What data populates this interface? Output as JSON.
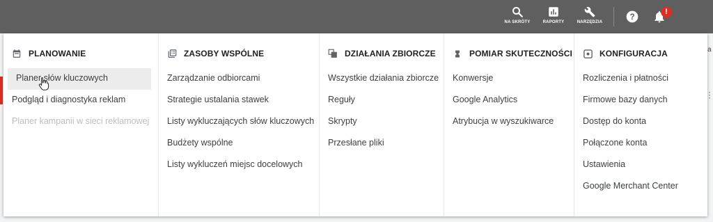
{
  "toolbar": {
    "search_label": "NA SKRÓTY",
    "reports_label": "RAPORTY",
    "tools_label": "NARZĘDZIA",
    "notification_badge": "!",
    "icons": [
      "search-icon",
      "reports-icon",
      "wrench-icon",
      "help-icon",
      "bell-icon"
    ]
  },
  "behind": {
    "fragment": "a"
  },
  "menu": {
    "columns": [
      {
        "icon": "calendar-icon",
        "title": "PLANOWANIE",
        "items": [
          {
            "label": "Planer słów kluczowych",
            "state": "hover"
          },
          {
            "label": "Podgląd i diagnostyka reklam",
            "state": "normal"
          },
          {
            "label": "Planer kampanii w sieci reklamowej",
            "state": "disabled"
          }
        ]
      },
      {
        "icon": "library-icon",
        "title": "ZASOBY WSPÓLNE",
        "items": [
          {
            "label": "Zarządzanie odbiorcami"
          },
          {
            "label": "Strategie ustalania stawek"
          },
          {
            "label": "Listy wykluczających słów kluczowych"
          },
          {
            "label": "Budżety wspólne"
          },
          {
            "label": "Listy wykluczeń miejsc docelowych"
          }
        ]
      },
      {
        "icon": "bulk-actions-icon",
        "title": "DZIAŁANIA ZBIORCZE",
        "items": [
          {
            "label": "Wszystkie działania zbiorcze"
          },
          {
            "label": "Reguły"
          },
          {
            "label": "Skrypty"
          },
          {
            "label": "Przesłane pliki"
          }
        ]
      },
      {
        "icon": "hourglass-icon",
        "title": "POMIAR SKUTECZNOŚCI",
        "items": [
          {
            "label": "Konwersje"
          },
          {
            "label": "Google Analytics"
          },
          {
            "label": "Atrybucja w wyszukiwarce"
          }
        ]
      },
      {
        "icon": "settings-icon",
        "title": "KONFIGURACJA",
        "items": [
          {
            "label": "Rozliczenia i płatności"
          },
          {
            "label": "Firmowe bazy danych"
          },
          {
            "label": "Dostęp do konta"
          },
          {
            "label": "Połączone konta"
          },
          {
            "label": "Ustawienia"
          },
          {
            "label": "Google Merchant Center"
          }
        ]
      }
    ]
  },
  "colors": {
    "topbar": "#5f5f5f",
    "badge": "#d93025",
    "hover_bg": "#ececec",
    "disabled_text": "#bdbdbd"
  }
}
